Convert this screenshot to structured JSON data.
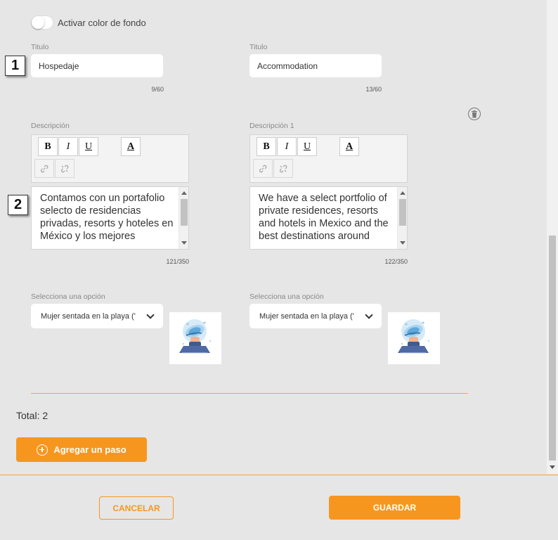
{
  "toggle": {
    "label": "Activar color de fondo",
    "on": false
  },
  "columns": [
    {
      "title_label": "Titulo",
      "title_value": "Hospedaje",
      "title_counter": "9/60",
      "description_label": "Descripción",
      "description_text": "Contamos con un portafolio selecto de residencias privadas, resorts y hoteles en México y los mejores",
      "description_counter": "121/350",
      "select_label": "Selecciona una opción",
      "select_value": "Mujer sentada en la playa ('"
    },
    {
      "title_label": "Titulo",
      "title_value": "Accommodation",
      "title_counter": "13/60",
      "description_label": "Descripción 1",
      "description_text": "We have a select portfolio of private residences, resorts and hotels in Mexico and the best destinations around",
      "description_counter": "122/350",
      "select_label": "Selecciona una opción",
      "select_value": "Mujer sentada en la playa ('"
    }
  ],
  "toolbar": {
    "bold": "B",
    "italic": "I",
    "underline": "U",
    "font_color": "A"
  },
  "badges": {
    "one": "1",
    "two": "2"
  },
  "total": "Total: 2",
  "add_step_label": "Agregar un paso",
  "footer": {
    "cancel_label": "CANCELAR",
    "save_label": "GUARDAR"
  },
  "colors": {
    "accent": "#f7961f",
    "background": "#e6e6e6"
  },
  "icons": {
    "delete": "trash-icon",
    "add": "plus-circle-icon",
    "link": "link-icon",
    "unlink": "unlink-icon"
  }
}
